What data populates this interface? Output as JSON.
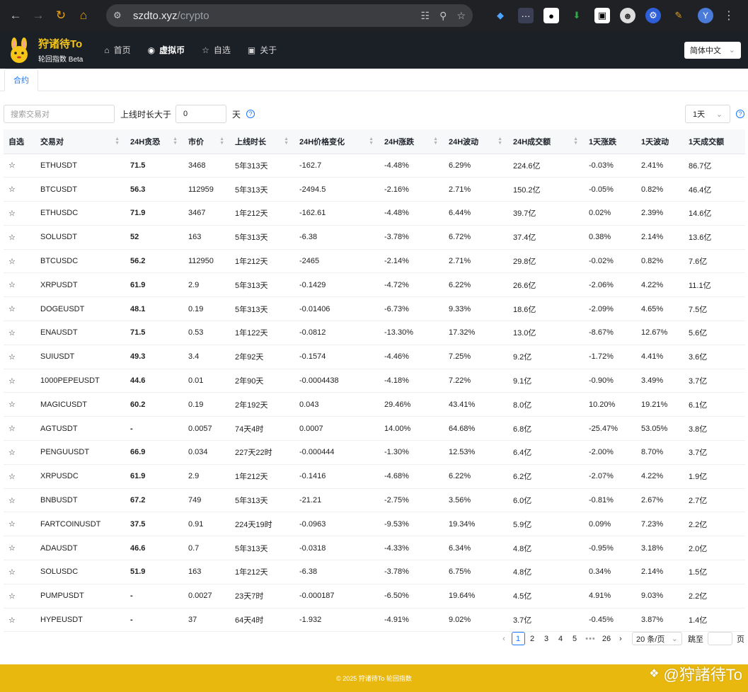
{
  "browser": {
    "url_host": "szdto.xyz",
    "url_path": "/crypto",
    "profile_initial": "Y"
  },
  "site": {
    "brand_title": "狩诸待To",
    "brand_sub": "轮回指数 Beta",
    "nav": [
      {
        "label": "首页",
        "icon": "home-icon"
      },
      {
        "label": "虚拟币",
        "icon": "coin-icon"
      },
      {
        "label": "自选",
        "icon": "star-icon"
      },
      {
        "label": "关于",
        "icon": "info-icon"
      }
    ],
    "language": "简体中文"
  },
  "tabs": [
    {
      "label": "合约"
    }
  ],
  "filters": {
    "search_placeholder": "搜索交易对",
    "online_label": "上线时长大于",
    "online_value": "0",
    "online_unit": "天",
    "period": "1天"
  },
  "table": {
    "headers": [
      "自选",
      "交易对",
      "24H贪恐",
      "市价",
      "上线时长",
      "24H价格变化",
      "24H涨跌",
      "24H波动",
      "24H成交额",
      "1天涨跌",
      "1天波动",
      "1天成交额"
    ],
    "rows": [
      {
        "pair": "ETHUSDT",
        "fg": "71.5",
        "price": "3468",
        "age": "5年313天",
        "chg": "-162.7",
        "pct": "-4.48%",
        "vol": "6.29%",
        "turnover": "224.6亿",
        "d_pct": "-0.03%",
        "d_vol": "2.41%",
        "d_turnover": "86.7亿"
      },
      {
        "pair": "BTCUSDT",
        "fg": "56.3",
        "price": "112959",
        "age": "5年313天",
        "chg": "-2494.5",
        "pct": "-2.16%",
        "vol": "2.71%",
        "turnover": "150.2亿",
        "d_pct": "-0.05%",
        "d_vol": "0.82%",
        "d_turnover": "46.4亿"
      },
      {
        "pair": "ETHUSDC",
        "fg": "71.9",
        "price": "3467",
        "age": "1年212天",
        "chg": "-162.61",
        "pct": "-4.48%",
        "vol": "6.44%",
        "turnover": "39.7亿",
        "d_pct": "0.02%",
        "d_vol": "2.39%",
        "d_turnover": "14.6亿"
      },
      {
        "pair": "SOLUSDT",
        "fg": "52",
        "price": "163",
        "age": "5年313天",
        "chg": "-6.38",
        "pct": "-3.78%",
        "vol": "6.72%",
        "turnover": "37.4亿",
        "d_pct": "0.38%",
        "d_vol": "2.14%",
        "d_turnover": "13.6亿"
      },
      {
        "pair": "BTCUSDC",
        "fg": "56.2",
        "price": "112950",
        "age": "1年212天",
        "chg": "-2465",
        "pct": "-2.14%",
        "vol": "2.71%",
        "turnover": "29.8亿",
        "d_pct": "-0.02%",
        "d_vol": "0.82%",
        "d_turnover": "7.6亿"
      },
      {
        "pair": "XRPUSDT",
        "fg": "61.9",
        "price": "2.9",
        "age": "5年313天",
        "chg": "-0.1429",
        "pct": "-4.72%",
        "vol": "6.22%",
        "turnover": "26.6亿",
        "d_pct": "-2.06%",
        "d_vol": "4.22%",
        "d_turnover": "11.1亿"
      },
      {
        "pair": "DOGEUSDT",
        "fg": "48.1",
        "price": "0.19",
        "age": "5年313天",
        "chg": "-0.01406",
        "pct": "-6.73%",
        "vol": "9.33%",
        "turnover": "18.6亿",
        "d_pct": "-2.09%",
        "d_vol": "4.65%",
        "d_turnover": "7.5亿"
      },
      {
        "pair": "ENAUSDT",
        "fg": "71.5",
        "price": "0.53",
        "age": "1年122天",
        "chg": "-0.0812",
        "pct": "-13.30%",
        "vol": "17.32%",
        "turnover": "13.0亿",
        "d_pct": "-8.67%",
        "d_vol": "12.67%",
        "d_turnover": "5.6亿"
      },
      {
        "pair": "SUIUSDT",
        "fg": "49.3",
        "price": "3.4",
        "age": "2年92天",
        "chg": "-0.1574",
        "pct": "-4.46%",
        "vol": "7.25%",
        "turnover": "9.2亿",
        "d_pct": "-1.72%",
        "d_vol": "4.41%",
        "d_turnover": "3.6亿"
      },
      {
        "pair": "1000PEPEUSDT",
        "fg": "44.6",
        "price": "0.01",
        "age": "2年90天",
        "chg": "-0.0004438",
        "pct": "-4.18%",
        "vol": "7.22%",
        "turnover": "9.1亿",
        "d_pct": "-0.90%",
        "d_vol": "3.49%",
        "d_turnover": "3.7亿"
      },
      {
        "pair": "MAGICUSDT",
        "fg": "60.2",
        "price": "0.19",
        "age": "2年192天",
        "chg": "0.043",
        "pct": "29.46%",
        "vol": "43.41%",
        "turnover": "8.0亿",
        "d_pct": "10.20%",
        "d_vol": "19.21%",
        "d_turnover": "6.1亿"
      },
      {
        "pair": "AGTUSDT",
        "fg": "-",
        "price": "0.0057",
        "age": "74天4时",
        "chg": "0.0007",
        "pct": "14.00%",
        "vol": "64.68%",
        "turnover": "6.8亿",
        "d_pct": "-25.47%",
        "d_vol": "53.05%",
        "d_turnover": "3.8亿"
      },
      {
        "pair": "PENGUUSDT",
        "fg": "66.9",
        "price": "0.034",
        "age": "227天22时",
        "chg": "-0.000444",
        "pct": "-1.30%",
        "vol": "12.53%",
        "turnover": "6.4亿",
        "d_pct": "-2.00%",
        "d_vol": "8.70%",
        "d_turnover": "3.7亿"
      },
      {
        "pair": "XRPUSDC",
        "fg": "61.9",
        "price": "2.9",
        "age": "1年212天",
        "chg": "-0.1416",
        "pct": "-4.68%",
        "vol": "6.22%",
        "turnover": "6.2亿",
        "d_pct": "-2.07%",
        "d_vol": "4.22%",
        "d_turnover": "1.9亿"
      },
      {
        "pair": "BNBUSDT",
        "fg": "67.2",
        "price": "749",
        "age": "5年313天",
        "chg": "-21.21",
        "pct": "-2.75%",
        "vol": "3.56%",
        "turnover": "6.0亿",
        "d_pct": "-0.81%",
        "d_vol": "2.67%",
        "d_turnover": "2.7亿"
      },
      {
        "pair": "FARTCOINUSDT",
        "fg": "37.5",
        "price": "0.91",
        "age": "224天19时",
        "chg": "-0.0963",
        "pct": "-9.53%",
        "vol": "19.34%",
        "turnover": "5.9亿",
        "d_pct": "0.09%",
        "d_vol": "7.23%",
        "d_turnover": "2.2亿"
      },
      {
        "pair": "ADAUSDT",
        "fg": "46.6",
        "price": "0.7",
        "age": "5年313天",
        "chg": "-0.0318",
        "pct": "-4.33%",
        "vol": "6.34%",
        "turnover": "4.8亿",
        "d_pct": "-0.95%",
        "d_vol": "3.18%",
        "d_turnover": "2.0亿"
      },
      {
        "pair": "SOLUSDC",
        "fg": "51.9",
        "price": "163",
        "age": "1年212天",
        "chg": "-6.38",
        "pct": "-3.78%",
        "vol": "6.75%",
        "turnover": "4.8亿",
        "d_pct": "0.34%",
        "d_vol": "2.14%",
        "d_turnover": "1.5亿"
      },
      {
        "pair": "PUMPUSDT",
        "fg": "-",
        "price": "0.0027",
        "age": "23天7时",
        "chg": "-0.000187",
        "pct": "-6.50%",
        "vol": "19.64%",
        "turnover": "4.5亿",
        "d_pct": "4.91%",
        "d_vol": "9.03%",
        "d_turnover": "2.2亿"
      },
      {
        "pair": "HYPEUSDT",
        "fg": "-",
        "price": "37",
        "age": "64天4时",
        "chg": "-1.932",
        "pct": "-4.91%",
        "vol": "9.02%",
        "turnover": "3.7亿",
        "d_pct": "-0.45%",
        "d_vol": "3.87%",
        "d_turnover": "1.4亿"
      }
    ]
  },
  "pagination": {
    "pages": [
      "1",
      "2",
      "3",
      "4",
      "5"
    ],
    "ellipsis": "•••",
    "last": "26",
    "page_size": "20 条/页",
    "jump_label": "跳至",
    "page_label": "页"
  },
  "footer": {
    "text": "© 2025 狩诸待To 轮回指数",
    "watermark": "@狩諸待To"
  },
  "colors": {
    "brand_yellow": "#f5c518",
    "header_bg": "#1b1f26",
    "link_blue": "#3b7fd9",
    "negative": "#e63b4e",
    "positive": "#52c41a"
  }
}
